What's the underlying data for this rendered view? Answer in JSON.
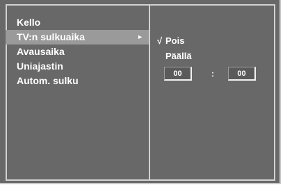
{
  "menu": {
    "items": [
      {
        "label": "Kello"
      },
      {
        "label": "TV:n sulkuaika"
      },
      {
        "label": "Avausaika"
      },
      {
        "label": "Uniajastin"
      },
      {
        "label": "Autom. sulku"
      }
    ],
    "selected_arrow": "►"
  },
  "submenu": {
    "check_mark": "√",
    "options": [
      {
        "label": "Pois",
        "checked": true
      },
      {
        "label": "Päällä",
        "checked": false
      }
    ],
    "time": {
      "hours": "00",
      "separator": ":",
      "minutes": "00"
    }
  },
  "colors": {
    "background": "#686868",
    "highlight": "#9a9a9a",
    "text": "#ffffff",
    "frame": "#d2d2d2"
  }
}
